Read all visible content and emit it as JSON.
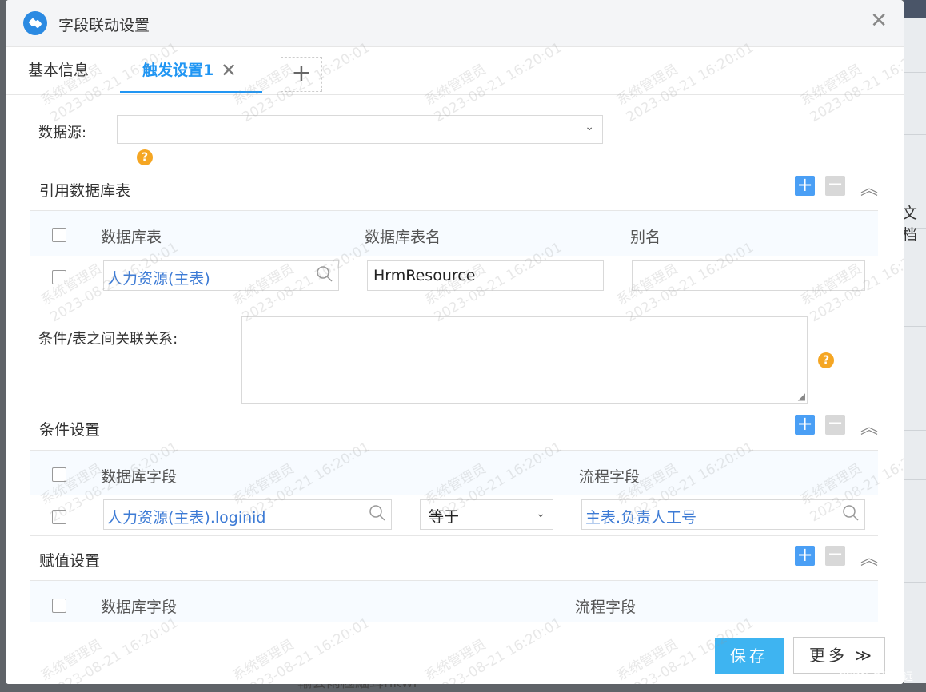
{
  "dialog": {
    "title": "字段联动设置",
    "close_glyph": "✕"
  },
  "tabs": {
    "basic": "基本信息",
    "trigger": "触发设置1",
    "trigger_close": "✕",
    "add": "+"
  },
  "datasource": {
    "label": "数据源:",
    "value": "",
    "arrow": "⌄"
  },
  "help_glyph": "?",
  "ref_tables": {
    "title": "引用数据库表",
    "headers": [
      "数据库表",
      "数据库表名",
      "别名"
    ],
    "rows": [
      {
        "table": "人力资源(主表)",
        "table_name": "HrmResource",
        "alias": ""
      }
    ]
  },
  "relation": {
    "label": "条件/表之间关联关系:",
    "value": ""
  },
  "conditions": {
    "title": "条件设置",
    "headers": [
      "数据库字段",
      "流程字段"
    ],
    "rows": [
      {
        "db_field": "人力资源(主表).loginid",
        "operator": "等于",
        "flow_field": "主表.负责人工号"
      }
    ]
  },
  "assign": {
    "title": "赋值设置",
    "headers": [
      "数据库字段",
      "流程字段"
    ]
  },
  "toolbar": {
    "plus": "+",
    "minus": "−",
    "collapse": "︽"
  },
  "footer": {
    "save": "保存",
    "more": "更多",
    "more_chevron": "≫"
  },
  "watermark": {
    "line1": "系统管理员",
    "line2": "2023-08-21 16:20:01"
  },
  "background": {
    "side_text": "文档",
    "bottom_text": "輸会雨極緬耳nkwl"
  },
  "credit": "CSDN @梁子远",
  "colors": {
    "accent": "#2196f3",
    "save_button": "#3eb4f1",
    "help": "#f5a623",
    "link_value": "#3d7bd5"
  }
}
